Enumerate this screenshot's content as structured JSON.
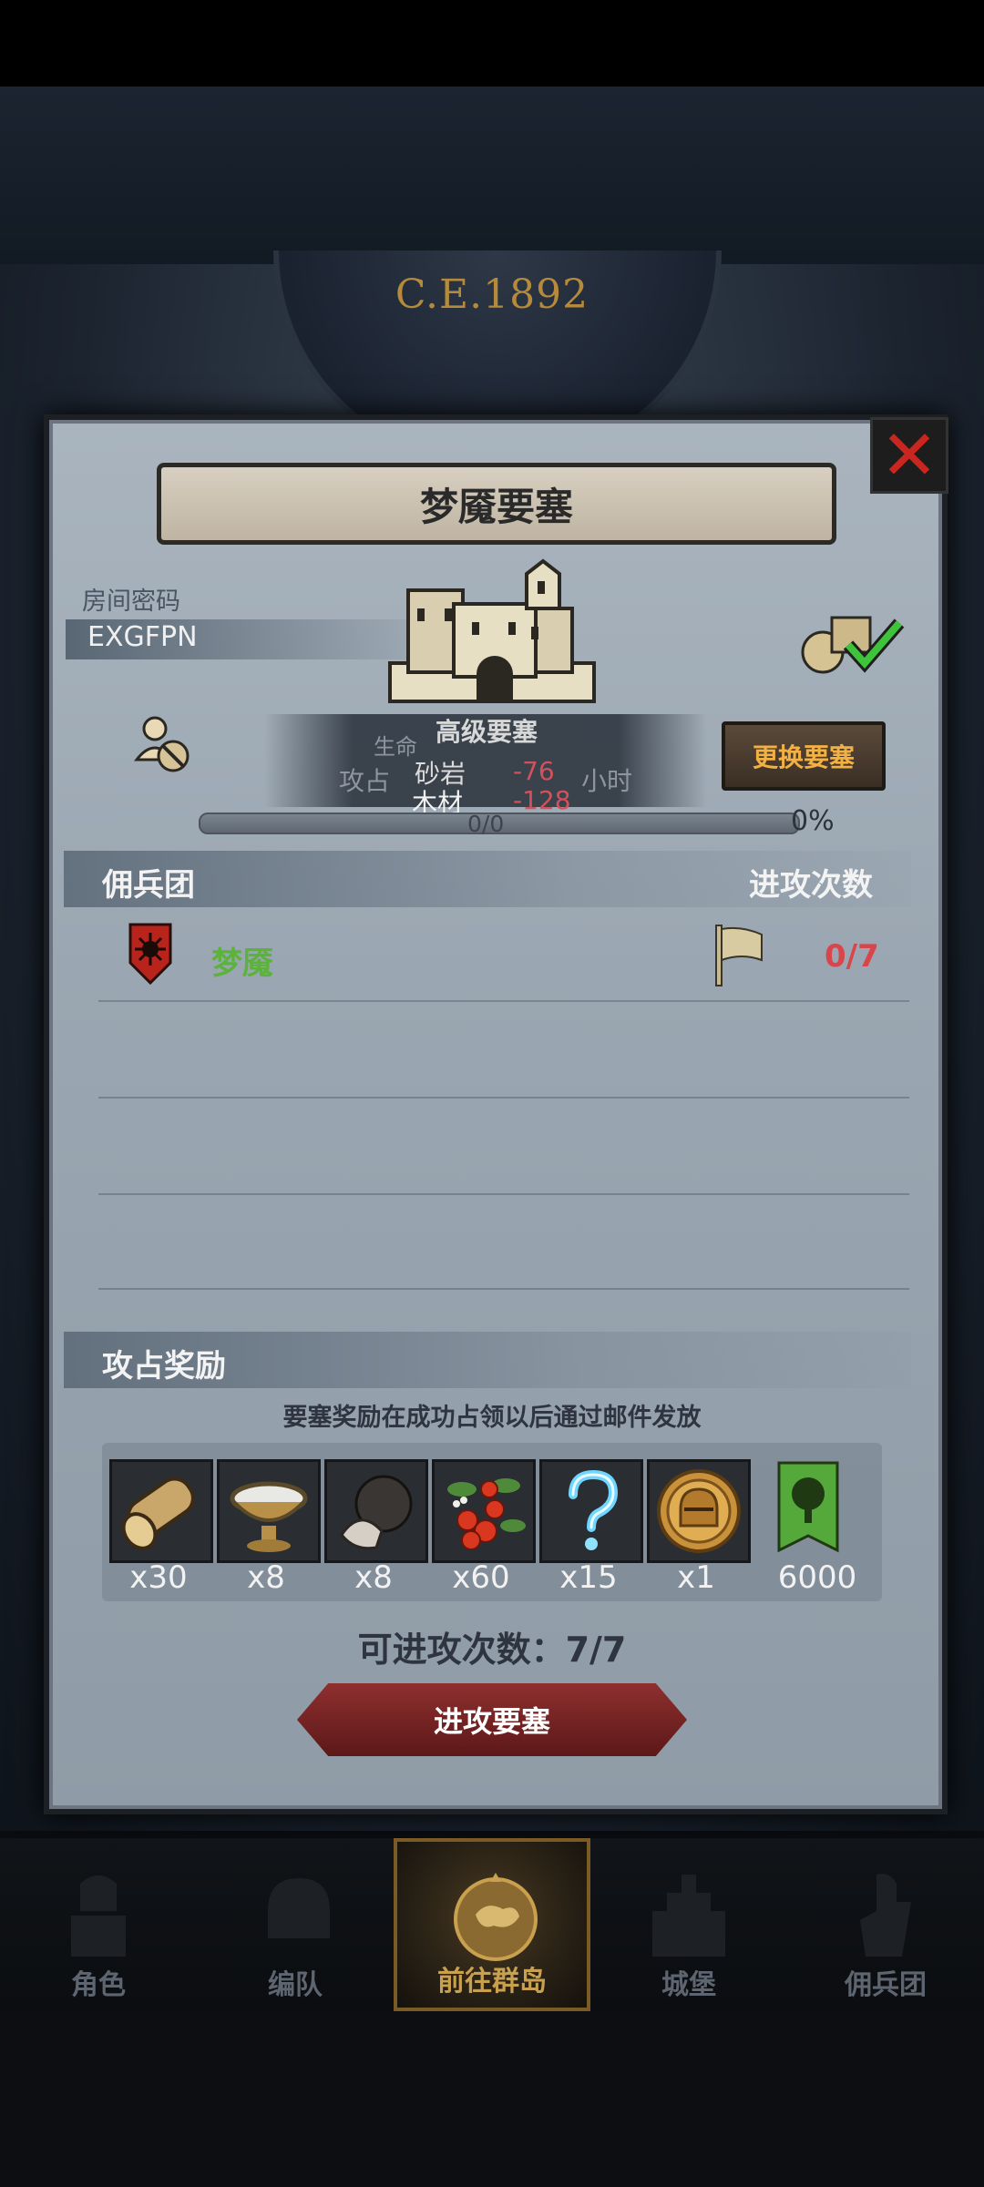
{
  "era": "C.E.1892",
  "dialog": {
    "title": "梦魇要塞",
    "room_code_label": "房间密码",
    "room_code": "EXGFPN",
    "fortress_level": "高级要塞",
    "info_hp_label": "生命",
    "info_faded_left": "攻占",
    "info_faded_right": "小时",
    "stone_label": "砂岩",
    "stone_value": "-76",
    "wood_label": "木材",
    "wood_value": "-128",
    "change_button": "更换要塞",
    "progress_count": "0/0",
    "progress_percent": "0%",
    "progress_value": 0,
    "mercenary_header": "佣兵团",
    "attack_count_header": "进攻次数",
    "mercenary_name": "梦魇",
    "mercenary_attacks": "0/7",
    "reward_header": "攻占奖励",
    "reward_note": "要塞奖励在成功占领以后通过邮件发放",
    "rewards": [
      {
        "icon": "wood-log-icon",
        "qty": "x30"
      },
      {
        "icon": "milk-bowl-icon",
        "qty": "x8"
      },
      {
        "icon": "truffle-icon",
        "qty": "x8"
      },
      {
        "icon": "berries-icon",
        "qty": "x60"
      },
      {
        "icon": "mystery-question-icon",
        "qty": "x15"
      },
      {
        "icon": "knight-helmet-medal-icon",
        "qty": "x1"
      },
      {
        "icon": "tree-banner-icon",
        "qty": "6000"
      }
    ],
    "attacks_left": "可进攻次数：7/7",
    "attack_button": "进攻要塞"
  },
  "nav": [
    {
      "label": "角色",
      "icon": "knight-armor-icon"
    },
    {
      "label": "编队",
      "icon": "helmet-squad-icon"
    },
    {
      "label": "前往群岛",
      "icon": "compass-map-icon",
      "active": true
    },
    {
      "label": "城堡",
      "icon": "castle-icon"
    },
    {
      "label": "佣兵团",
      "icon": "mercenary-icon"
    }
  ],
  "colors": {
    "accent_gold": "#f3b043",
    "negative_red": "#d4505a",
    "mercenary_green": "#5bb33c",
    "attack_button": "#8f2f2f"
  }
}
